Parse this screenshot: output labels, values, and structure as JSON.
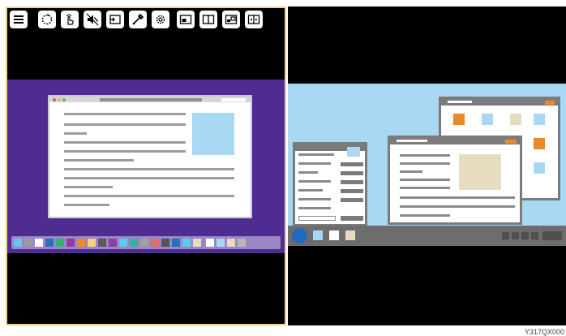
{
  "toolbar": {
    "buttons": [
      {
        "icon": "hamburger-menu-icon"
      },
      {
        "icon": "rotate-icon"
      },
      {
        "icon": "hand-touch-icon"
      },
      {
        "icon": "speaker-mute-icon"
      },
      {
        "icon": "input-source-icon"
      },
      {
        "icon": "eyedropper-icon"
      },
      {
        "icon": "gear-icon"
      },
      {
        "icon": "picture-in-picture-icon"
      },
      {
        "icon": "split-view-icon"
      },
      {
        "icon": "picture-in-picture-alt-icon"
      },
      {
        "icon": "swap-windows-icon"
      }
    ]
  },
  "colors": {
    "selection_border": "#f0d28c",
    "mac_desktop": "#4e2c91",
    "win_desktop": "#a9d8f2",
    "window_frame": "#7b7b7b"
  },
  "watermark": "Y317QX000"
}
